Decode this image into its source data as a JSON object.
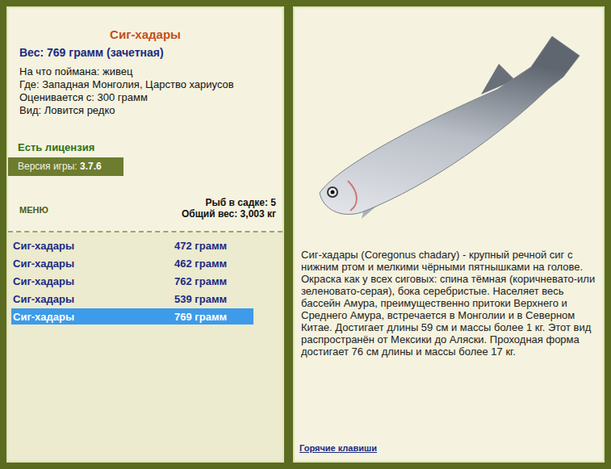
{
  "fish_card": {
    "title": "Сиг-хадары",
    "weight": "Вес: 769 грамм (зачетная)",
    "details": [
      "На что поймана: живец",
      "Где: Западная Монголия, Царство хариусов",
      "Оценивается с: 300 грамм",
      "Вид: Ловится редко"
    ]
  },
  "license": "Есть лицензия",
  "version": {
    "label": "Версия игры:",
    "value": "3.7.6"
  },
  "menu": "МЕНЮ",
  "keepnet": {
    "count": "Рыб в садке: 5",
    "total": "Общий вес: 3,003 кг"
  },
  "catches": [
    {
      "name": "Сиг-хадары",
      "weight": "472 грамм",
      "selected": false
    },
    {
      "name": "Сиг-хадары",
      "weight": "462 грамм",
      "selected": false
    },
    {
      "name": "Сиг-хадары",
      "weight": "762 грамм",
      "selected": false
    },
    {
      "name": "Сиг-хадары",
      "weight": "539 грамм",
      "selected": false
    },
    {
      "name": "Сиг-хадары",
      "weight": "769 грамм",
      "selected": true
    }
  ],
  "description": "Сиг-хадары (Coregonus chadary) - крупный речной сиг с нижним ртом и мелкими чёрными пятнышками на голове. Окраска как у всех сиговых: спина тёмная (коричневато-или зеленовато-серая), бока серебристые. Населяет весь бассейн Амура, преимущественно притоки Верхнего и Среднего Амура, встречается в Монголии и в Северном Китае. Достигает длины 59 см и массы более 1 кг. Этот вид распространён от Мексики до Аляски. Проходная форма достигает 76 см длины и массы более 17 кг.",
  "hotkeys": "Горячие клавиши"
}
